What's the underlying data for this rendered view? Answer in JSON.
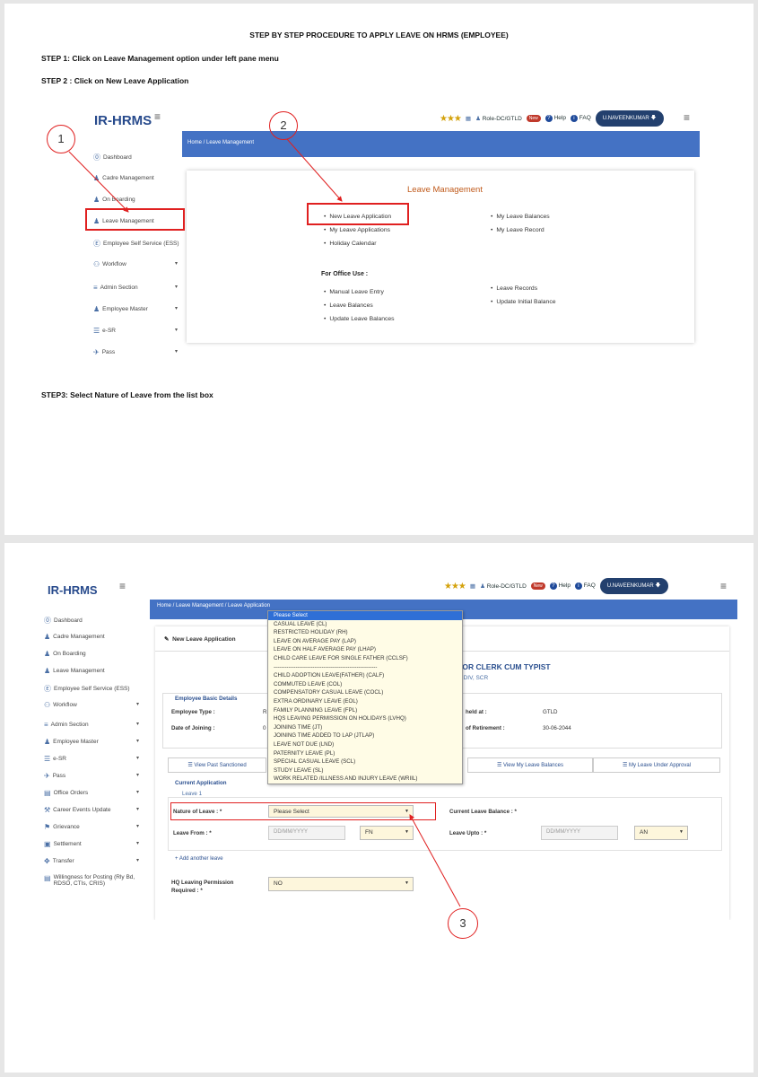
{
  "page1": {
    "title": "STEP BY STEP PROCEDURE TO APPLY LEAVE ON   HRMS (EMPLOYEE)",
    "step1": "STEP 1: Click on Leave Management option under left pane menu",
    "step2": "STEP 2 :  Click on New Leave Application",
    "step3": "STEP3:  Select Nature of Leave  from the list box",
    "shot": {
      "logo": "IR-HRMS",
      "role": "Role-DC/GTLD",
      "help": "Help",
      "faq": "FAQ",
      "user": "U.NAVEENKUMAR",
      "breadcrumb": "Home  /  Leave Management",
      "sidebar": [
        "Dashboard",
        "Cadre Management",
        "On Boarding",
        "Leave Management",
        "Employee Self Service (ESS)",
        "Workflow",
        "Admin Section",
        "Employee Master",
        "e-SR",
        "Pass"
      ],
      "panel_title": "Leave Management",
      "left_links": [
        "New Leave Application",
        "My Leave Applications",
        "Holiday Calendar"
      ],
      "right_links": [
        "My Leave Balances",
        "My Leave Record"
      ],
      "office_use_heading": "For Office Use :",
      "office_left": [
        "Manual Leave Entry",
        "Leave Balances",
        "Update Leave Balances"
      ],
      "office_right": [
        "Leave Records",
        "Update Initial Balance"
      ],
      "marker1": "1",
      "marker2": "2"
    }
  },
  "page2": {
    "shot": {
      "logo": "IR-HRMS",
      "role": "Role-DC/GTLD",
      "new_badge": "New",
      "help": "Help",
      "faq": "FAQ",
      "user": "U.NAVEENKUMAR",
      "breadcrumb": "Home  /  Leave Management  /  Leave Application",
      "sidebar": [
        "Dashboard",
        "Cadre Management",
        "On Boarding",
        "Leave Management",
        "Employee Self Service (ESS)",
        "Workflow",
        "Admin Section",
        "Employee Master",
        "e-SR",
        "Pass",
        "Office Orders",
        "Career Events Update",
        "Grievance",
        "Settlement",
        "Transfer",
        "Willingness for Posting (Rly Bd, RDSO, CTIs, CRIS)"
      ],
      "form_header": "New Leave Application",
      "designation": "IOR CLERK CUM TYPIST",
      "division": "/ DIV, SCR",
      "basic_details": "Employee Basic Details",
      "employee_type_label": "Employee Type :",
      "employee_type_val": "R",
      "date_joining_label": "Date of Joining :",
      "date_joining_val": "0",
      "held_at_label": "held at :",
      "held_at_val": "GTLD",
      "retirement_label": "of Retirement :",
      "retirement_val": "30-06-2044",
      "tab_past": "View Past Sanctioned",
      "tab_balances": "View My Leave Balances",
      "tab_approval": "My Leave Under Approval",
      "current_app": "Current Application",
      "leave1": "Leave 1",
      "nature_label": "Nature of Leave : *",
      "nature_value": "Please Select",
      "balance_label": "Current Leave Balance : *",
      "from_label": "Leave From : *",
      "from_placeholder": "DD/MM/YYYY",
      "from_session": "FN",
      "upto_label": "Leave Upto : *",
      "upto_placeholder": "DD/MM/YYYY",
      "upto_session": "AN",
      "add_another": "+ Add another leave",
      "hq_label": "HQ Leaving Permission Required : *",
      "hq_value": "NO",
      "dropdown": [
        "Please Select",
        "CASUAL LEAVE (CL)",
        "RESTRICTED HOLIDAY (RH)",
        "LEAVE ON AVERAGE PAY (LAP)",
        "LEAVE ON HALF AVERAGE PAY (LHAP)",
        "CHILD CARE LEAVE FOR SINGLE FATHER (CCLSF)",
        "--------------------------------------------------------",
        "CHILD ADOPTION LEAVE(FATHER) (CALF)",
        "COMMUTED LEAVE (COL)",
        "COMPENSATORY CASUAL LEAVE (COCL)",
        "EXTRA ORDINARY LEAVE (EOL)",
        "FAMILY PLANNING LEAVE (FPL)",
        "HQS LEAVING PERMISSION ON HOLIDAYS (LVHQ)",
        "JOINING TIME (JT)",
        "JOINING TIME ADDED TO LAP (JTLAP)",
        "LEAVE NOT DUE (LND)",
        "PATERNITY LEAVE (PL)",
        "SPECIAL CASUAL LEAVE (SCL)",
        "STUDY LEAVE (SL)",
        "WORK RELATED /ILLNESS AND INJURY LEAVE (WRIIL)"
      ],
      "marker3": "3"
    }
  }
}
